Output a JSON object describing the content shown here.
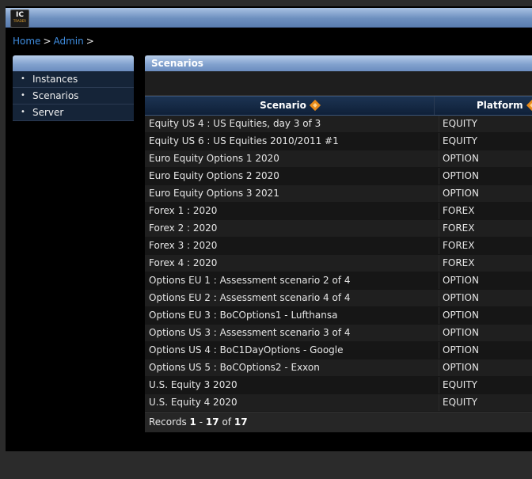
{
  "logo": {
    "main": "IC",
    "sub": "TRADER"
  },
  "breadcrumb": {
    "home": "Home",
    "admin": "Admin",
    "separator": ">"
  },
  "sidebar": {
    "items": [
      {
        "label": "Instances"
      },
      {
        "label": "Scenarios"
      },
      {
        "label": "Server"
      }
    ]
  },
  "panel": {
    "title": "Scenarios"
  },
  "table": {
    "columns": {
      "scenario": "Scenario",
      "platform": "Platform"
    },
    "rows": [
      {
        "scenario": "Equity US 4 : US Equities, day 3 of 3",
        "platform": "EQUITY"
      },
      {
        "scenario": "Equity US 6 : US Equities 2010/2011 #1",
        "platform": "EQUITY"
      },
      {
        "scenario": "Euro Equity Options 1 2020",
        "platform": "OPTION"
      },
      {
        "scenario": "Euro Equity Options 2 2020",
        "platform": "OPTION"
      },
      {
        "scenario": "Euro Equity Options 3 2021",
        "platform": "OPTION"
      },
      {
        "scenario": "Forex 1 : 2020",
        "platform": "FOREX"
      },
      {
        "scenario": "Forex 2 : 2020",
        "platform": "FOREX"
      },
      {
        "scenario": "Forex 3 : 2020",
        "platform": "FOREX"
      },
      {
        "scenario": "Forex 4 : 2020",
        "platform": "FOREX"
      },
      {
        "scenario": "Options EU 1 : Assessment scenario 2 of 4",
        "platform": "OPTION"
      },
      {
        "scenario": "Options EU 2 : Assessment scenario 4 of 4",
        "platform": "OPTION"
      },
      {
        "scenario": "Options EU 3 : BoCOptions1 - Lufthansa",
        "platform": "OPTION"
      },
      {
        "scenario": "Options US 3 : Assessment scenario 3 of 4",
        "platform": "OPTION"
      },
      {
        "scenario": "Options US 4 : BoC1DayOptions - Google",
        "platform": "OPTION"
      },
      {
        "scenario": "Options US 5 : BoCOptions2 - Exxon",
        "platform": "OPTION"
      },
      {
        "scenario": "U.S. Equity 3 2020",
        "platform": "EQUITY"
      },
      {
        "scenario": "U.S. Equity 4 2020",
        "platform": "EQUITY"
      }
    ]
  },
  "footer": {
    "prefix": "Records",
    "start": "1",
    "dash": "-",
    "end": "17",
    "of": "of",
    "total": "17"
  }
}
